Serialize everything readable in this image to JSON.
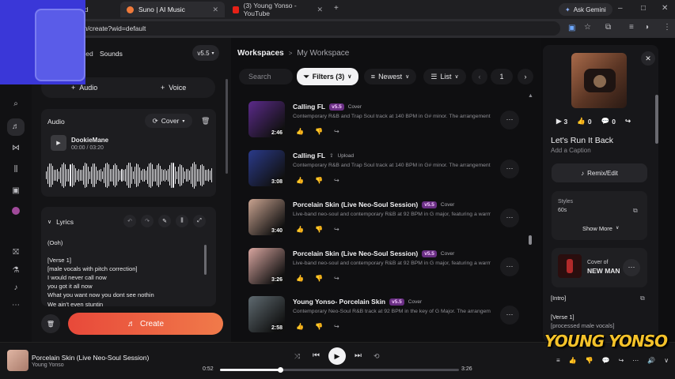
{
  "browser": {
    "tabs": [
      {
        "label": "rd",
        "active": false
      },
      {
        "label": "Suno | AI Music",
        "active": true
      },
      {
        "label": "(3) Young Yonso - YouTube",
        "active": false
      }
    ],
    "new_tab": "+",
    "gemini_label": "Ask Gemini",
    "url": ".com/create?wid=default",
    "window_controls": [
      "–",
      "□",
      "✕"
    ]
  },
  "create_panel": {
    "tabs": [
      "ced",
      "Sounds"
    ],
    "version": "v5.5",
    "audio_button": "Audio",
    "voice_button": "Voice",
    "audio_card": {
      "title": "Audio",
      "mode": "Cover",
      "track_name": "DookieMane",
      "track_time": "00:00 / 03:20"
    },
    "lyrics": {
      "title": "Lyrics",
      "lines": [
        "(Ooh)",
        "",
        "[Verse 1]",
        "[male vocals with pitch correction]",
        "I would never call now",
        "you  got it all now",
        "What you want now you dont see nothin",
        "We ain't even stuntin"
      ]
    },
    "create_label": "Create"
  },
  "workspace": {
    "breadcrumb_root": "Workspaces",
    "breadcrumb_sep": ">",
    "breadcrumb_current": "My Workspace",
    "search_placeholder": "Search",
    "filters_label": "Filters (3)",
    "sort_label": "Newest",
    "view_label": "List",
    "page_number": "1",
    "songs": [
      {
        "title": "Calling FL",
        "version": "v5.5",
        "tag": "Cover",
        "duration": "2:46",
        "desc": "Contemporary R&B and Trap Soul track at 140 BPM in G# minor. The arrangement f...",
        "cover": "#5b2a8a"
      },
      {
        "title": "Calling FL",
        "version": "",
        "tag": "Upload",
        "duration": "3:08",
        "desc": "Contemporary R&B and Trap Soul track at 140 BPM in G# minor. The arrangement f...",
        "cover": "#2a3a8a"
      },
      {
        "title": "Porcelain Skin (Live Neo-Soul Session)",
        "version": "v5.5",
        "tag": "Cover",
        "duration": "3:40",
        "desc": "Live-band neo-soul and contemporary R&B at 92 BPM in G major, featuring a warm...",
        "cover": "#c9a390"
      },
      {
        "title": "Porcelain Skin (Live Neo-Soul Session)",
        "version": "v5.5",
        "tag": "Cover",
        "duration": "3:26",
        "desc": "Live-band neo-soul and contemporary R&B at 92 BPM in G major, featuring a warm...",
        "cover": "#d9a6a0"
      },
      {
        "title": "Young Yonso- Porcelain Skin",
        "version": "v5.5",
        "tag": "Cover",
        "duration": "2:58",
        "desc": "Contemporary Neo-Soul R&B track at 92 BPM in the key of G Major. The arrangement...",
        "cover": "#5f6a70"
      }
    ]
  },
  "detail": {
    "plays": "3",
    "likes": "0",
    "comments": "0",
    "title": "Let's Run It Back",
    "caption_placeholder": "Add a Caption",
    "remix_label": "Remix/Edit",
    "styles_label": "Styles",
    "styles_value": "60s",
    "show_more": "Show More",
    "cover_of_label": "Cover of",
    "cover_of_song": "NEW MAN",
    "lyrics_lines": [
      "[Intro]",
      "",
      "[Verse 1]",
      "[processed male vocals]"
    ]
  },
  "player": {
    "title": "Porcelain Skin (Live Neo-Soul Session)",
    "artist": "Young Yonso",
    "current_time": "0:52",
    "total_time": "3:26",
    "progress": 0.25
  },
  "watermark": "YOUNG YONSO",
  "colors": {
    "accent_gradient_start": "#e8493a",
    "accent_gradient_end": "#f07a4a",
    "version_badge": "#6a2f84"
  }
}
